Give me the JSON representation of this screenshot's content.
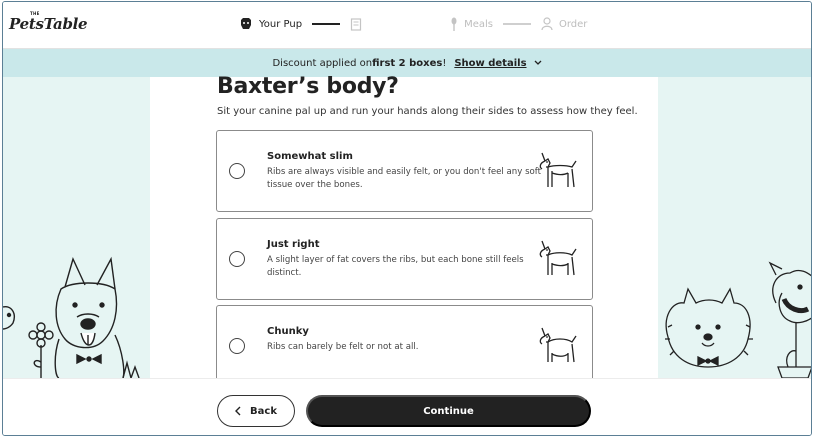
{
  "header": {
    "logo_small": "THE",
    "logo_name": "PetsTable",
    "steps": [
      {
        "label": "Your Pup",
        "icon": "dog-face-icon",
        "state": "active"
      },
      {
        "label": "",
        "icon": "food-box-icon",
        "state": "dim"
      },
      {
        "label": "Meals",
        "icon": "spoon-icon",
        "state": "dim"
      },
      {
        "label": "Order",
        "icon": "person-icon",
        "state": "dim"
      }
    ]
  },
  "banner": {
    "text_before": "Discount applied on ",
    "bold": "first 2 boxes",
    "text_after": "!",
    "link": "Show details",
    "link_icon": "chevron-down-icon"
  },
  "main": {
    "title": "Baxter’s body?",
    "subtitle": "Sit your canine pal up and run your hands along their sides to assess how they feel.",
    "options": [
      {
        "title": "Somewhat slim",
        "desc": "Ribs are always visible and easily felt, or you don't feel any soft tissue over the bones.",
        "icon": "slim-dog-icon"
      },
      {
        "title": "Just right",
        "desc": "A slight layer of fat covers the ribs, but each bone still feels distinct.",
        "icon": "normal-dog-icon"
      },
      {
        "title": "Chunky",
        "desc": "Ribs can barely be felt or not at all.",
        "icon": "chunky-dog-icon"
      }
    ]
  },
  "footer": {
    "back_label": "Back",
    "back_icon": "chevron-left-icon",
    "continue_label": "Continue"
  },
  "colors": {
    "banner_bg": "#c9e8ea",
    "side_bg": "#e6f5f3",
    "primary_button": "#222222"
  }
}
